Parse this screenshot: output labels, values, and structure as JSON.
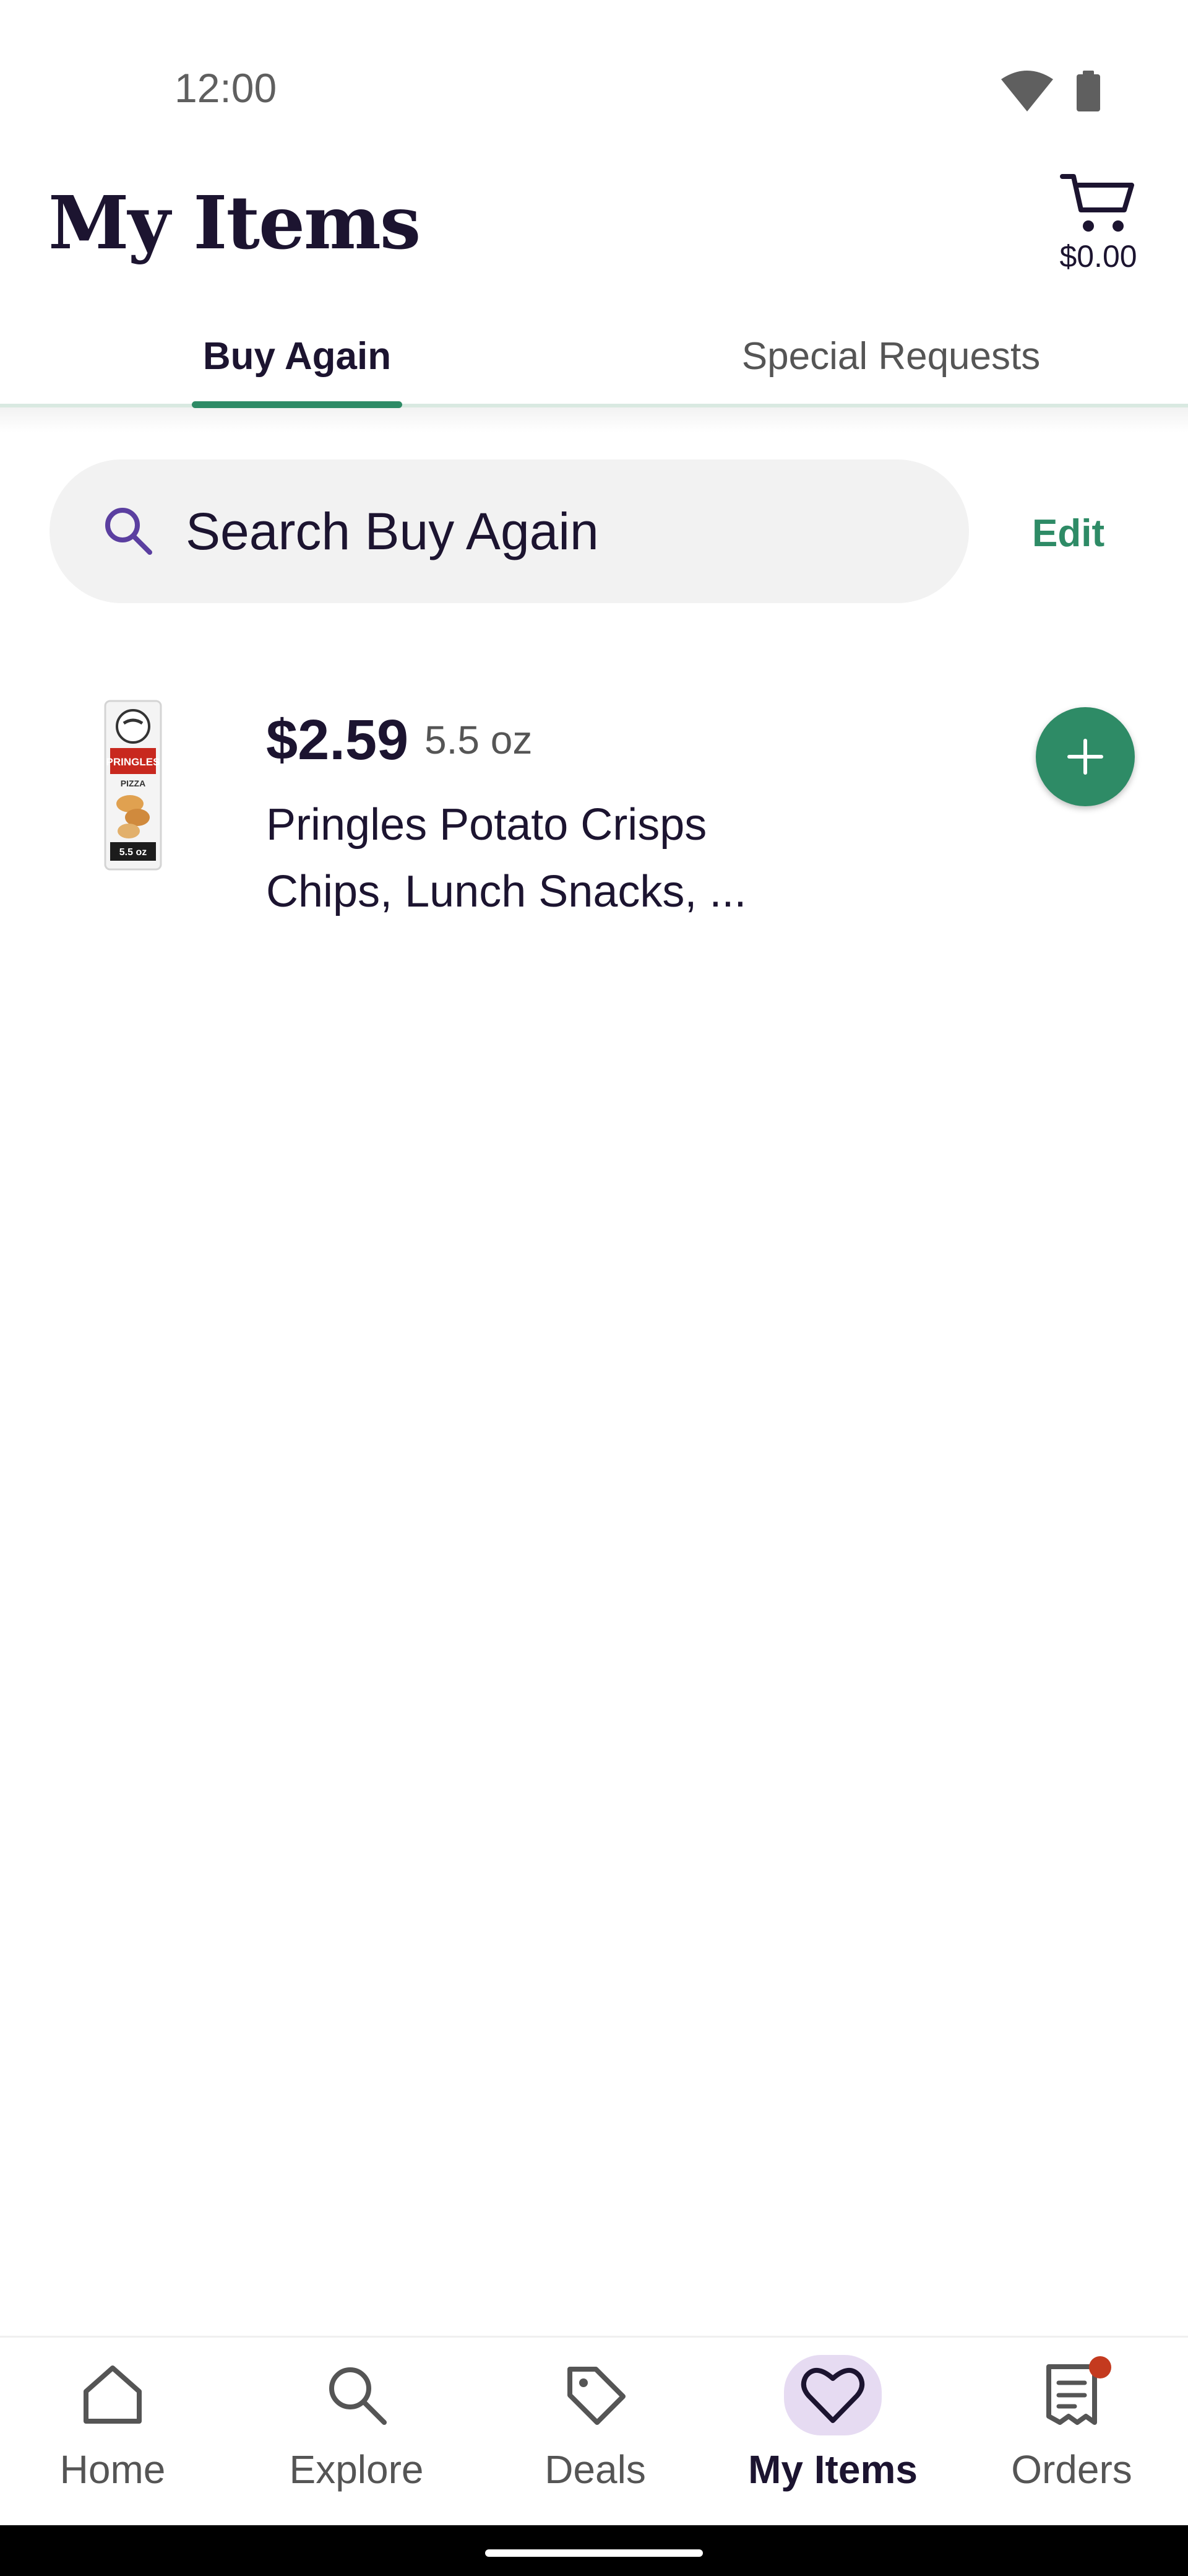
{
  "status_bar": {
    "time": "12:00",
    "icons": [
      "wifi-icon",
      "battery-icon"
    ]
  },
  "header": {
    "title": "My Items",
    "cart_total": "$0.00",
    "cart_icon": "cart-icon"
  },
  "tabs": [
    {
      "label": "Buy Again",
      "active": true
    },
    {
      "label": "Special Requests",
      "active": false
    }
  ],
  "search": {
    "placeholder": "Search Buy Again",
    "icon": "search-icon",
    "edit_label": "Edit"
  },
  "items": [
    {
      "price": "$2.59",
      "size": "5.5 oz",
      "name": "Pringles Potato Crisps Chips, Lunch Snacks, ...",
      "image_text": [
        "PRINGLES",
        "PIZZA",
        "5.5 oz"
      ]
    }
  ],
  "bottom_nav": [
    {
      "label": "Home",
      "icon": "home-icon",
      "active": false
    },
    {
      "label": "Explore",
      "icon": "search-icon",
      "active": false
    },
    {
      "label": "Deals",
      "icon": "tag-icon",
      "active": false
    },
    {
      "label": "My Items",
      "icon": "heart-icon",
      "active": true
    },
    {
      "label": "Orders",
      "icon": "receipt-icon",
      "active": false,
      "badge": true
    }
  ],
  "colors": {
    "accent_green": "#2e8b66",
    "text_dark": "#1c1430",
    "search_bg": "#f2f2f2",
    "nav_active_bg": "#e6dbf2",
    "badge_red": "#c43a1f",
    "search_icon": "#5b3fa0"
  }
}
